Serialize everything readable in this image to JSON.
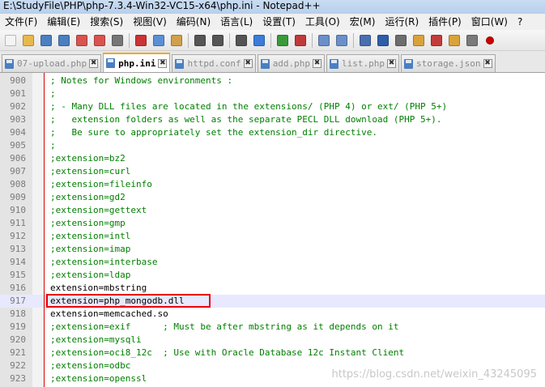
{
  "window": {
    "title": "E:\\StudyFile\\PHP\\php-7.3.4-Win32-VC15-x64\\php.ini - Notepad++"
  },
  "menu": {
    "items": [
      "文件(F)",
      "编辑(E)",
      "搜索(S)",
      "视图(V)",
      "编码(N)",
      "语言(L)",
      "设置(T)",
      "工具(O)",
      "宏(M)",
      "运行(R)",
      "插件(P)",
      "窗口(W)",
      "?"
    ]
  },
  "toolbar": {
    "icons": [
      "new-file-icon",
      "open-file-icon",
      "save-icon",
      "save-all-icon",
      "close-icon",
      "close-all-icon",
      "print-icon",
      "cut-icon",
      "copy-icon",
      "paste-icon",
      "undo-icon",
      "redo-icon",
      "find-icon",
      "replace-icon",
      "zoom-in-icon",
      "zoom-out-icon",
      "sync-v-icon",
      "sync-h-icon",
      "word-wrap-icon",
      "all-chars-icon",
      "indent-guide-icon",
      "doc-map-icon",
      "function-list-icon",
      "folder-icon",
      "monitor-icon",
      "record-icon"
    ]
  },
  "tabs": [
    {
      "label": "07-upload.php",
      "active": false
    },
    {
      "label": "php.ini",
      "active": true
    },
    {
      "label": "httpd.conf",
      "active": false
    },
    {
      "label": "add.php",
      "active": false
    },
    {
      "label": "list.php",
      "active": false
    },
    {
      "label": "storage.json",
      "active": false
    }
  ],
  "editor": {
    "current_line": "917",
    "lines": [
      {
        "n": "900",
        "text": "; Notes for Windows environments :",
        "type": "comment"
      },
      {
        "n": "901",
        "text": ";",
        "type": "comment"
      },
      {
        "n": "902",
        "text": "; - Many DLL files are located in the extensions/ (PHP 4) or ext/ (PHP 5+)",
        "type": "comment"
      },
      {
        "n": "903",
        "text": ";   extension folders as well as the separate PECL DLL download (PHP 5+).",
        "type": "comment"
      },
      {
        "n": "904",
        "text": ";   Be sure to appropriately set the extension_dir directive.",
        "type": "comment"
      },
      {
        "n": "905",
        "text": ";",
        "type": "comment"
      },
      {
        "n": "906",
        "text": ";extension=bz2",
        "type": "comment"
      },
      {
        "n": "907",
        "text": ";extension=curl",
        "type": "comment"
      },
      {
        "n": "908",
        "text": ";extension=fileinfo",
        "type": "comment"
      },
      {
        "n": "909",
        "text": ";extension=gd2",
        "type": "comment"
      },
      {
        "n": "910",
        "text": ";extension=gettext",
        "type": "comment"
      },
      {
        "n": "911",
        "text": ";extension=gmp",
        "type": "comment"
      },
      {
        "n": "912",
        "text": ";extension=intl",
        "type": "comment"
      },
      {
        "n": "913",
        "text": ";extension=imap",
        "type": "comment"
      },
      {
        "n": "914",
        "text": ";extension=interbase",
        "type": "comment"
      },
      {
        "n": "915",
        "text": ";extension=ldap",
        "type": "comment"
      },
      {
        "n": "916",
        "text": "extension=mbstring",
        "type": "plain"
      },
      {
        "n": "917",
        "text": "extension=php_mongodb.dll",
        "type": "plain"
      },
      {
        "n": "918",
        "text": "extension=memcached.so",
        "type": "plain"
      },
      {
        "n": "919",
        "text": ";extension=exif      ; Must be after mbstring as it depends on it",
        "type": "comment"
      },
      {
        "n": "920",
        "text": ";extension=mysqli",
        "type": "comment"
      },
      {
        "n": "921",
        "text": ";extension=oci8_12c  ; Use with Oracle Database 12c Instant Client",
        "type": "comment"
      },
      {
        "n": "922",
        "text": ";extension=odbc",
        "type": "comment"
      },
      {
        "n": "923",
        "text": ";extension=openssl",
        "type": "comment"
      }
    ]
  },
  "watermark": "https://blog.csdn.net/weixin_43245095",
  "colors": {
    "comment": "#007f00",
    "highlight_box": "#e8000b",
    "fold_line": "#e00000",
    "active_tab_accent": "#f5a623"
  }
}
